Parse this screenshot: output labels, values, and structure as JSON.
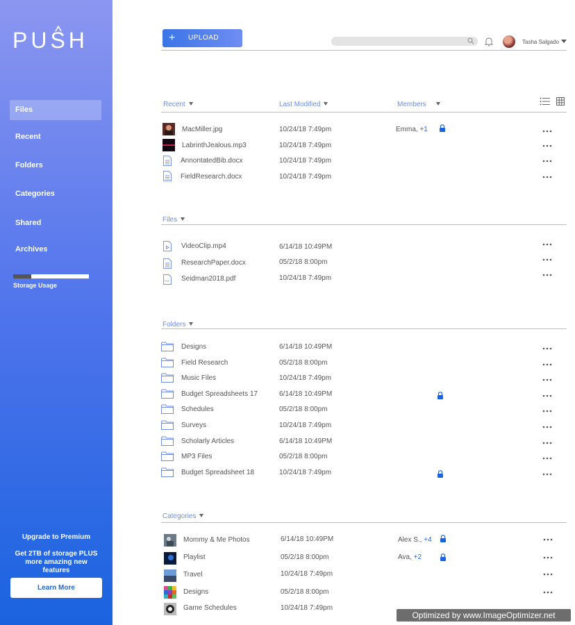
{
  "sidebar": {
    "logo": "PUSH",
    "items": [
      {
        "label": "Files"
      },
      {
        "label": "Recent"
      },
      {
        "label": "Folders"
      },
      {
        "label": "Categories"
      },
      {
        "label": "Shared"
      },
      {
        "label": "Archives"
      }
    ],
    "storage_label": "Storage Usage",
    "storage_used_fraction": 0.24,
    "upgrade_title": "Upgrade to Premium",
    "upgrade_desc": "Get 2TB of storage PLUS more amazing new features",
    "learn_more": "Learn More"
  },
  "topbar": {
    "upload_label": "UPLOAD",
    "search_placeholder": "",
    "user_name": "Tasha Salgado"
  },
  "columns": {
    "recent": "Recent",
    "last_modified": "Last Modified",
    "members": "Members"
  },
  "recent": [
    {
      "name": "MacMiller.jpg",
      "date": "10/24/18 7:49pm",
      "members": "Emma, ",
      "extra": "+1",
      "locked": true,
      "icon": "image-thumb"
    },
    {
      "name": "LabrinthJealous.mp3",
      "date": "10/24/18 7:49pm",
      "members": "",
      "extra": "",
      "locked": false,
      "icon": "audio-thumb"
    },
    {
      "name": "AnnontatedBib.docx",
      "date": "10/24/18 7:49pm",
      "members": "",
      "extra": "",
      "locked": false,
      "icon": "document-icon"
    },
    {
      "name": "FieldResearch.docx",
      "date": "10/24/18 7:49pm",
      "members": "",
      "extra": "",
      "locked": false,
      "icon": "document-icon"
    }
  ],
  "files": {
    "header": "Files",
    "items": [
      {
        "name": "VideoClip.mp4",
        "date": "6/14/18 10:49PM",
        "icon": "video-file-icon"
      },
      {
        "name": "ResearchPaper.docx",
        "date": "05/2/18 8:00pm",
        "icon": "document-icon"
      },
      {
        "name": "Seidman2018.pdf",
        "date": "10/24/18 7:49pm",
        "icon": "pdf-file-icon"
      }
    ]
  },
  "folders": {
    "header": "Folders",
    "items": [
      {
        "name": "Designs",
        "date": "6/14/18 10:49PM",
        "locked": false
      },
      {
        "name": "Field Research",
        "date": "05/2/18 8:00pm",
        "locked": false
      },
      {
        "name": "Music Files",
        "date": "10/24/18 7:49pm",
        "locked": false
      },
      {
        "name": "Budget Spreadsheets 17",
        "date": "6/14/18 10:49PM",
        "locked": true
      },
      {
        "name": "Schedules",
        "date": "05/2/18 8:00pm",
        "locked": false
      },
      {
        "name": "Surveys",
        "date": "10/24/18 7:49pm",
        "locked": false
      },
      {
        "name": "Scholarly Articles",
        "date": "6/14/18 10:49PM",
        "locked": false
      },
      {
        "name": "MP3 Files",
        "date": "05/2/18 8:00pm",
        "locked": false
      },
      {
        "name": "Budget Spreadsheet 18",
        "date": "10/24/18 7:49pm",
        "locked": true
      }
    ]
  },
  "categories": {
    "header": "Categories",
    "items": [
      {
        "name": "Mommy & Me Photos",
        "date": "6/14/18 10:49PM",
        "members": "Alex S., ",
        "extra": "+4",
        "locked": true
      },
      {
        "name": "Playlist",
        "date": "05/2/18 8:00pm",
        "members": "Ava, ",
        "extra": "+2",
        "locked": true
      },
      {
        "name": "Travel",
        "date": "10/24/18 7:49pm",
        "members": "",
        "extra": "",
        "locked": false
      },
      {
        "name": "Designs",
        "date": "05/2/18 8:00pm",
        "members": "",
        "extra": "",
        "locked": false
      },
      {
        "name": "Game Schedules",
        "date": "10/24/18 7:49pm",
        "members": "",
        "extra": "",
        "locked": false
      }
    ]
  },
  "watermark": "Optimized by www.ImageOptimizer.net",
  "colors": {
    "accent": "#2a6bd9",
    "header": "#6f8de8",
    "sidebar_top": "#8b96f0",
    "sidebar_bottom": "#1a63df"
  }
}
